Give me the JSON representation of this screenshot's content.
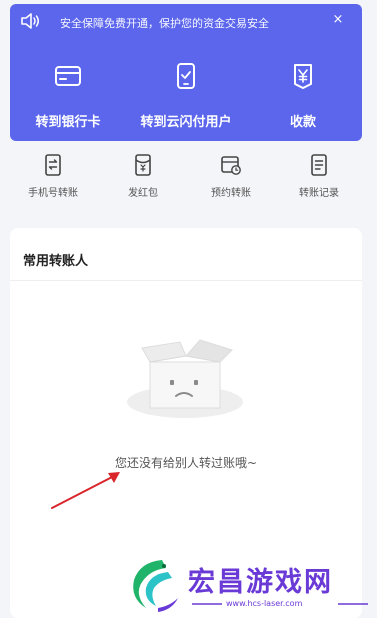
{
  "notice": {
    "text": "安全保障免费开通，保护您的资金交易安全",
    "close_label": "×"
  },
  "actions": [
    {
      "label": "转到银行卡",
      "icon": "bank-card-icon"
    },
    {
      "label": "转到云闪付用户",
      "icon": "phone-icon"
    },
    {
      "label": "收款",
      "icon": "receive-money-icon"
    }
  ],
  "quick": [
    {
      "label": "手机号转账",
      "icon": "phone-transfer-icon"
    },
    {
      "label": "发红包",
      "icon": "red-packet-icon"
    },
    {
      "label": "预约转账",
      "icon": "scheduled-transfer-icon"
    },
    {
      "label": "转账记录",
      "icon": "transfer-record-icon"
    }
  ],
  "card": {
    "title": "常用转账人",
    "empty_text": "您还没有给别人转过账哦~"
  },
  "watermark": {
    "title": "宏昌游戏网",
    "url": "www.hcs-laser.com"
  },
  "colors": {
    "brand_blue": "#5b66ec",
    "watermark_purple": "#6a3ad6",
    "annotation_red": "#d9262b"
  }
}
